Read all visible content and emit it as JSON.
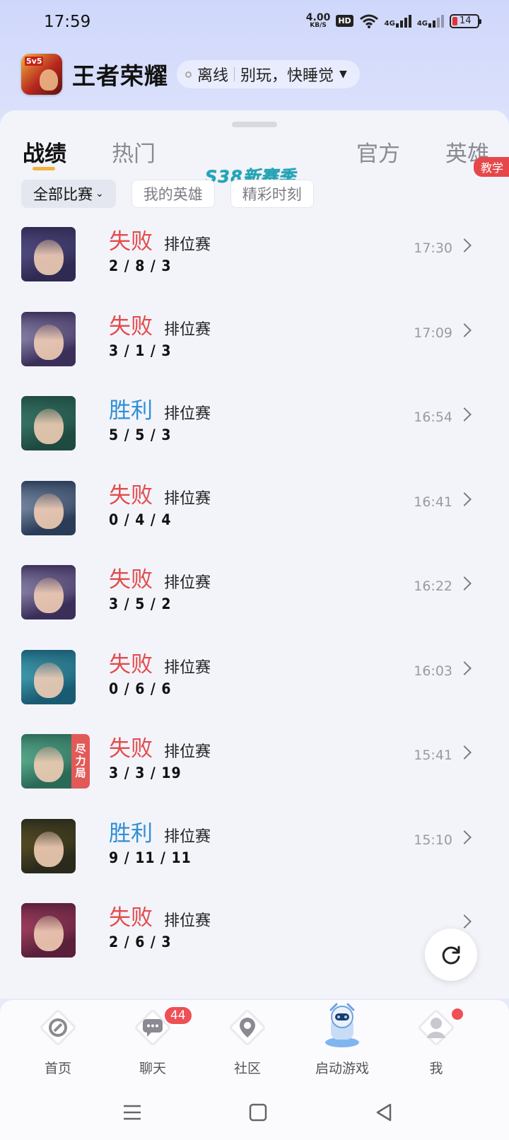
{
  "status_bar": {
    "time": "17:59",
    "net_speed_value": "4.00",
    "net_speed_unit": "KB/S",
    "hd": "HD",
    "sim1": "4G",
    "sim2": "4G",
    "battery": "14",
    "battery_color": "#e33333"
  },
  "header": {
    "logo_text": "5v5",
    "title": "王者荣耀",
    "presence": "离线",
    "signature": "别玩，快睡觉"
  },
  "tabs": [
    {
      "label": "战绩"
    },
    {
      "label": "热门"
    },
    {
      "label": "S38新赛季"
    },
    {
      "label": "官方"
    },
    {
      "label": "英雄"
    }
  ],
  "tab_badge": "教学",
  "filters": {
    "primary": "全部比赛",
    "secondary": [
      "我的英雄",
      "精彩时刻"
    ]
  },
  "matches": [
    {
      "result": "失败",
      "outcome": "loss",
      "mode": "排位赛",
      "kda": "2 / 8 / 3",
      "time": "17:30",
      "avatar_colors": [
        "#2e2a52",
        "#6f6aa8"
      ]
    },
    {
      "result": "失败",
      "outcome": "loss",
      "mode": "排位赛",
      "kda": "3 / 1 / 3",
      "time": "17:09",
      "avatar_colors": [
        "#3b2f5a",
        "#c9c6e8"
      ]
    },
    {
      "result": "胜利",
      "outcome": "win",
      "mode": "排位赛",
      "kda": "5 / 5 / 3",
      "time": "16:54",
      "avatar_colors": [
        "#1f4a40",
        "#4a9a86"
      ]
    },
    {
      "result": "失败",
      "outcome": "loss",
      "mode": "排位赛",
      "kda": "0 / 4 / 4",
      "time": "16:41",
      "avatar_colors": [
        "#2b3c58",
        "#b9c9e2"
      ]
    },
    {
      "result": "失败",
      "outcome": "loss",
      "mode": "排位赛",
      "kda": "3 / 5 / 2",
      "time": "16:22",
      "avatar_colors": [
        "#3b2f5a",
        "#c9c6e8"
      ]
    },
    {
      "result": "失败",
      "outcome": "loss",
      "mode": "排位赛",
      "kda": "0 / 6 / 6",
      "time": "16:03",
      "avatar_colors": [
        "#1a5b74",
        "#5fd2d8"
      ]
    },
    {
      "result": "失败",
      "outcome": "loss",
      "mode": "排位赛",
      "kda": "3 / 3 / 19",
      "time": "15:41",
      "avatar_colors": [
        "#2c6a58",
        "#7ee0b8"
      ],
      "tag": [
        "尽",
        "力",
        "局"
      ]
    },
    {
      "result": "胜利",
      "outcome": "win",
      "mode": "排位赛",
      "kda": "9 / 11 / 11",
      "time": "15:10",
      "avatar_colors": [
        "#2a2a1c",
        "#7a6a2a"
      ]
    },
    {
      "result": "失败",
      "outcome": "loss",
      "mode": "排位赛",
      "kda": "2 / 6 / 3",
      "time": "",
      "avatar_colors": [
        "#5a1f3a",
        "#d85a7c"
      ]
    }
  ],
  "bottom_nav": [
    {
      "label": "首页",
      "icon": "home-icon"
    },
    {
      "label": "聊天",
      "icon": "chat-icon",
      "badge": "44"
    },
    {
      "label": "社区",
      "icon": "community-icon"
    },
    {
      "label": "启动游戏",
      "icon": "launch-game-icon"
    },
    {
      "label": "我",
      "icon": "profile-icon",
      "dot": true
    }
  ],
  "colors": {
    "loss": "#e24c4c",
    "win": "#2f8fd5",
    "accent": "#f3b142",
    "badge": "#ef4f55"
  }
}
